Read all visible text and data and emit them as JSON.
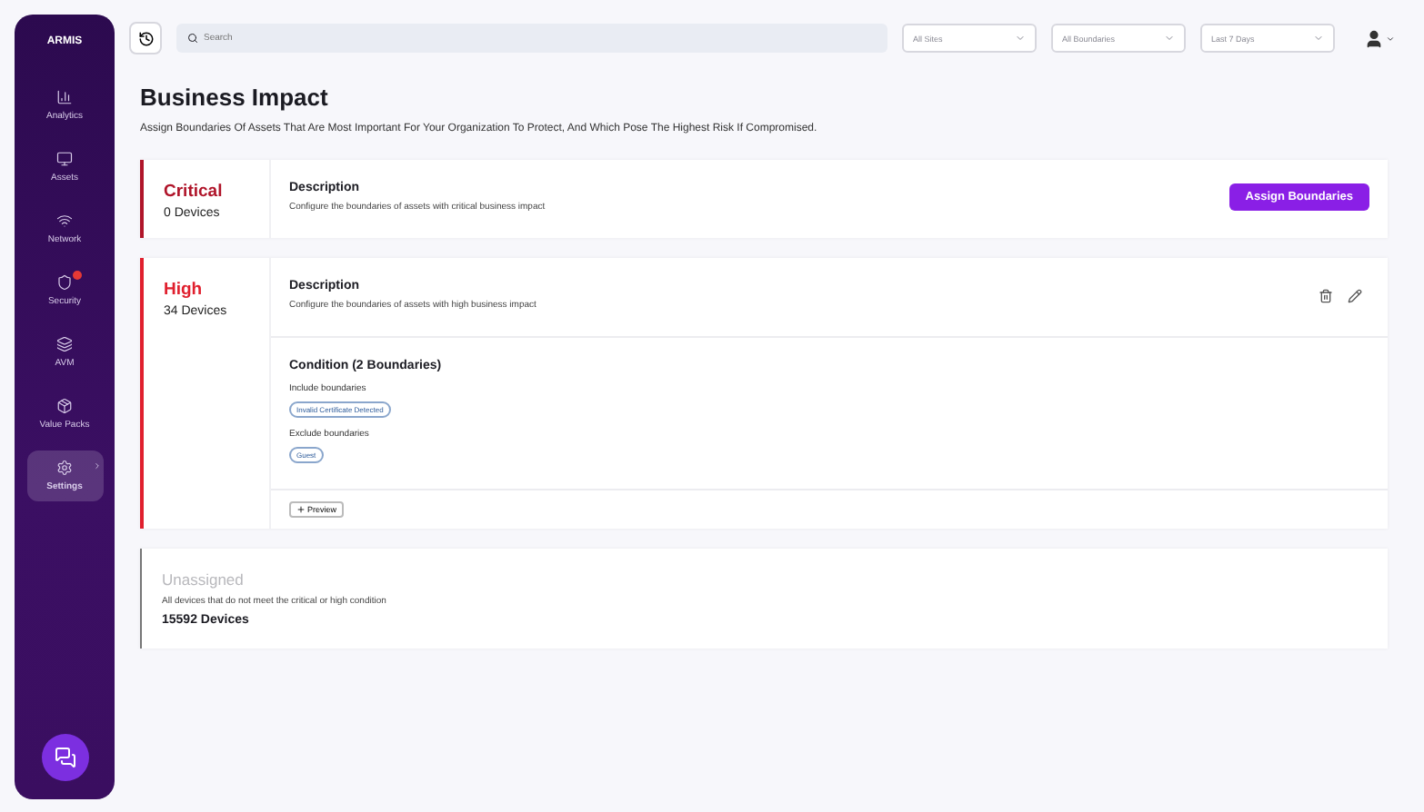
{
  "sidebar": {
    "logo": "ARMIS",
    "items": [
      {
        "label": "Analytics",
        "selected": false,
        "badge": false
      },
      {
        "label": "Assets",
        "selected": false,
        "badge": false
      },
      {
        "label": "Network",
        "selected": false,
        "badge": false
      },
      {
        "label": "Security",
        "selected": false,
        "badge": true
      },
      {
        "label": "AVM",
        "selected": false,
        "badge": false
      },
      {
        "label": "Value Packs",
        "selected": false,
        "badge": false
      },
      {
        "label": "Settings",
        "selected": true,
        "badge": false
      }
    ]
  },
  "topbar": {
    "search": {
      "placeholder": "Search"
    },
    "filters": [
      "All Sites",
      "All Boundaries",
      "Last 7 Days"
    ]
  },
  "page": {
    "title": "Business Impact",
    "subtitle": "Assign Boundaries Of Assets That Are Most Important For Your Organization To Protect, And Which Pose The Highest Risk If Compromised."
  },
  "cards": [
    {
      "kind": "empty",
      "level": "Critical",
      "color": "#b0152a",
      "devices": "0 Devices",
      "description_title": "Description",
      "description": "Configure the boundaries of assets with critical business impact",
      "button": "Assign Boundaries"
    },
    {
      "kind": "condition",
      "level": "High",
      "color": "#e0202e",
      "devices": "34 Devices",
      "description_title": "Description",
      "description": "Configure the boundaries of assets with high business impact",
      "condition_title": "Condition (2 Boundaries)",
      "groups": [
        {
          "label": "Include boundaries",
          "tags": [
            "Invalid Certificate Detected"
          ]
        },
        {
          "label": "Exclude boundaries",
          "tags": [
            "Guest"
          ]
        }
      ],
      "preview": "Preview"
    },
    {
      "kind": "unassigned",
      "level": "Unassigned",
      "color": "#b8b8bc",
      "description": "All devices that do not meet the critical or high condition",
      "devices": "15592 Devices"
    }
  ]
}
